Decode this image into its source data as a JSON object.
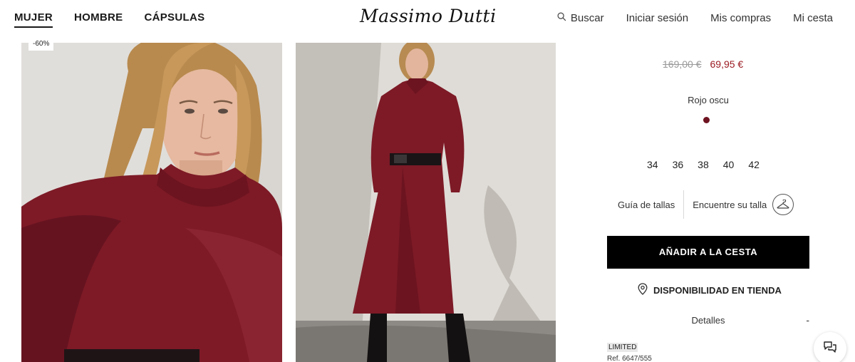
{
  "header": {
    "nav_left": [
      "MUJER",
      "HOMBRE",
      "CÁPSULAS"
    ],
    "logo": "Massimo Dutti",
    "search_label": "Buscar",
    "login_label": "Iniciar sesión",
    "orders_label": "Mis compras",
    "cart_label": "Mi cesta"
  },
  "gallery": {
    "discount_badge": "-60%"
  },
  "product": {
    "old_price": "169,00 €",
    "new_price": "69,95 €",
    "color_name": "Rojo oscu",
    "color_hex": "#6e1320",
    "sizes": [
      "34",
      "36",
      "38",
      "40",
      "42"
    ],
    "size_guide_label": "Guía de tallas",
    "find_size_label": "Encuentre su talla",
    "add_to_cart_label": "AÑADIR A LA CESTA",
    "store_availability_label": "DISPONIBILIDAD EN TIENDA",
    "details_label": "Detalles",
    "details_toggle": "-",
    "limited_label": "LIMITED",
    "reference": "Ref. 6647/555"
  },
  "colors": {
    "accent_price": "#9b1c23",
    "button_bg": "#000000"
  }
}
